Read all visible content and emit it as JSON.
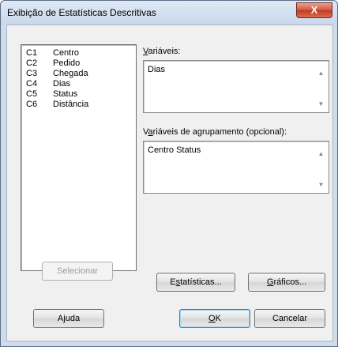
{
  "window": {
    "title": "Exibição de Estatísticas Descritivas",
    "close_label": "X"
  },
  "variables_list": [
    {
      "id": "C1",
      "name": "Centro"
    },
    {
      "id": "C2",
      "name": "Pedido"
    },
    {
      "id": "C3",
      "name": "Chegada"
    },
    {
      "id": "C4",
      "name": "Dias"
    },
    {
      "id": "C5",
      "name": "Status"
    },
    {
      "id": "C6",
      "name": "Distância"
    }
  ],
  "variables_field": {
    "label_mnemonic": "V",
    "label_rest": "ariáveis:",
    "value": "Dias"
  },
  "grouping_field": {
    "label_pre": "V",
    "label_mnemonic": "a",
    "label_rest": "riáveis de agrupamento (opcional):",
    "value": "Centro Status"
  },
  "buttons": {
    "select": "Selecionar",
    "stats_pre": "E",
    "stats_mnemonic": "s",
    "stats_rest": "tatísticas...",
    "graphs_mnemonic": "G",
    "graphs_rest": "ráficos...",
    "help": "Ajuda",
    "ok_mnemonic": "O",
    "ok_rest": "K",
    "cancel": "Cancelar"
  },
  "colors": {
    "close_button": "#c23a22",
    "default_button_border": "#3c7fb1"
  }
}
